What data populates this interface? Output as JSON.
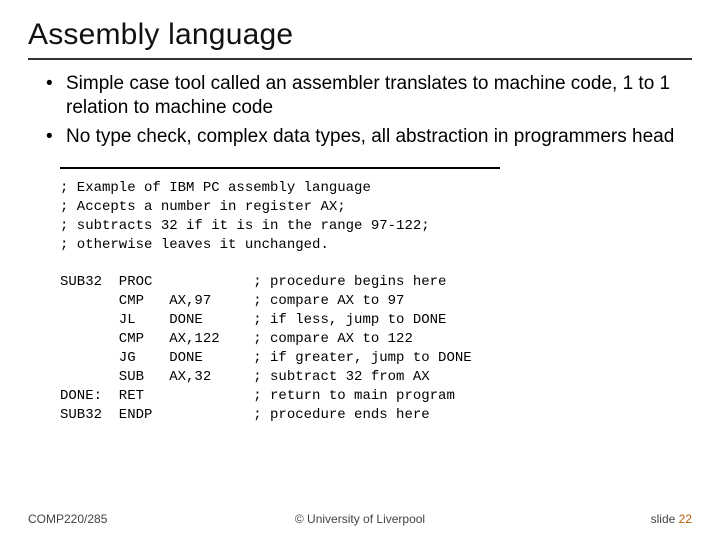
{
  "title": "Assembly language",
  "bullets": [
    "Simple case tool called an assembler translates to machine code, 1 to 1 relation to machine code",
    "No type check, complex data types, all abstraction in programmers head"
  ],
  "code": {
    "intro": [
      "; Example of IBM PC assembly language",
      "; Accepts a number in register AX;",
      "; subtracts 32 if it is in the range 97-122;",
      "; otherwise leaves it unchanged."
    ],
    "lines": [
      {
        "label": "SUB32",
        "op": "PROC",
        "args": "",
        "comment": "; procedure begins here"
      },
      {
        "label": "",
        "op": "CMP",
        "args": "AX,97",
        "comment": "; compare AX to 97"
      },
      {
        "label": "",
        "op": "JL",
        "args": "DONE",
        "comment": "; if less, jump to DONE"
      },
      {
        "label": "",
        "op": "CMP",
        "args": "AX,122",
        "comment": "; compare AX to 122"
      },
      {
        "label": "",
        "op": "JG",
        "args": "DONE",
        "comment": "; if greater, jump to DONE"
      },
      {
        "label": "",
        "op": "SUB",
        "args": "AX,32",
        "comment": "; subtract 32 from AX"
      },
      {
        "label": "DONE:",
        "op": "RET",
        "args": "",
        "comment": "; return to main program"
      },
      {
        "label": "SUB32",
        "op": "ENDP",
        "args": "",
        "comment": "; procedure ends here"
      }
    ]
  },
  "footer": {
    "left": "COMP220/285",
    "center": "© University of Liverpool",
    "right_label": "slide",
    "right_number": "22"
  }
}
